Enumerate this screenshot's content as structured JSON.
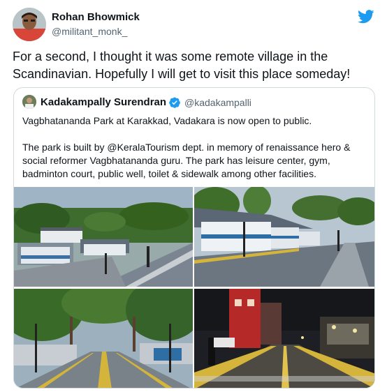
{
  "tweet": {
    "author_name": "Rohan Bhowmick",
    "author_handle": "@militant_monk_",
    "text": "For a second, I thought it was some remote village in the Scandinavian. Hopefully I will get to visit this place someday!",
    "platform_icon": "twitter-bird-icon",
    "accent_color": "#1d9bf0"
  },
  "quoted_tweet": {
    "author_name": "Kadakampally Surendran",
    "verified_icon": "verified-badge-icon",
    "author_handle": "@kadakampalli",
    "text_line_1": "Vagbhatananda Park at Karakkad, Vadakara is now open to public.",
    "text_paragraph_2": "The park is built by @KeralaTourism dept. in memory of renaissance hero & social reformer Vagbhatananda guru. The park has leisure center, gym, badminton court, public well, toilet & sidewalk among other facilities.",
    "photos": [
      {
        "id": "photo-1",
        "description_icon": "park-aerial-photo"
      },
      {
        "id": "photo-2",
        "description_icon": "park-building-photo"
      },
      {
        "id": "photo-3",
        "description_icon": "tree-lined-walkway-photo"
      },
      {
        "id": "photo-4",
        "description_icon": "night-walkway-photo"
      }
    ]
  }
}
